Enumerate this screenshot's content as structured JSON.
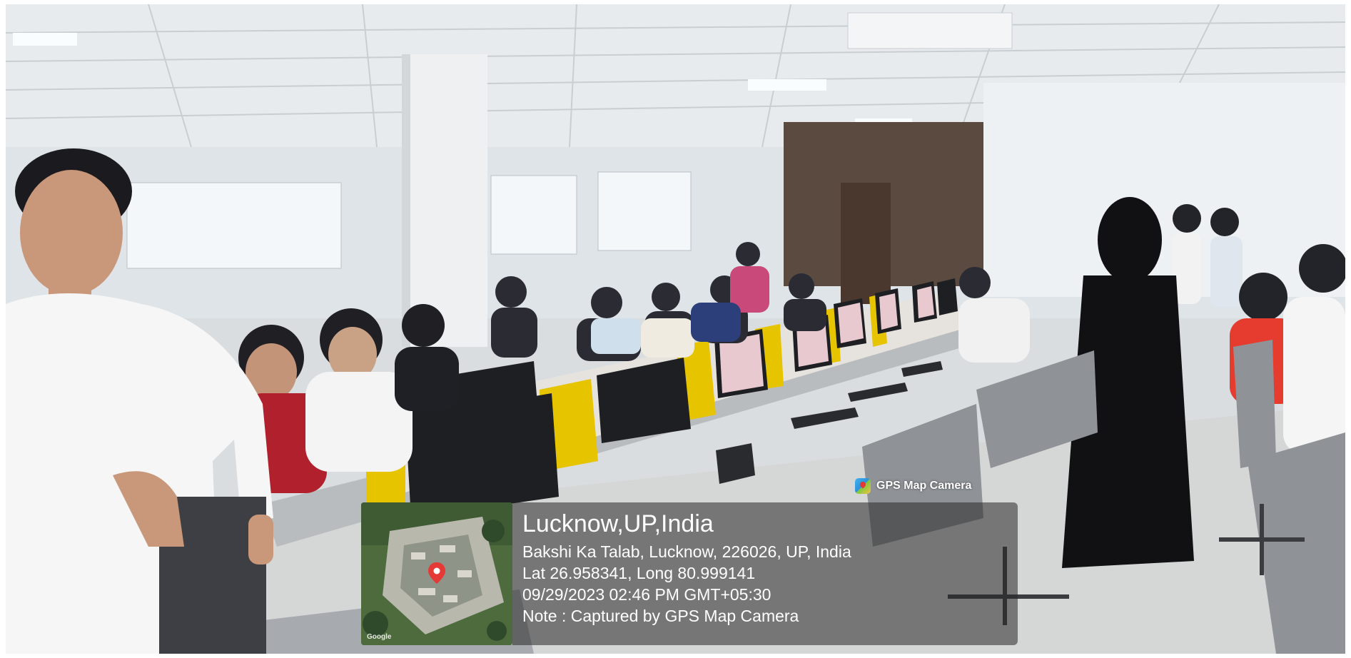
{
  "photo": {
    "scene_description_icon": "computer-lab-photo",
    "gps_overlay": {
      "app_name": "GPS Map Camera",
      "map_attribution": "Google",
      "place": "Lucknow,UP,India",
      "address": "Bakshi Ka Talab, Lucknow, 226026, UP, India",
      "coordinates": "Lat 26.958341, Long 80.999141",
      "datetime": "09/29/2023 02:46 PM GMT+05:30",
      "note": "Note : Captured by GPS Map Camera"
    }
  }
}
